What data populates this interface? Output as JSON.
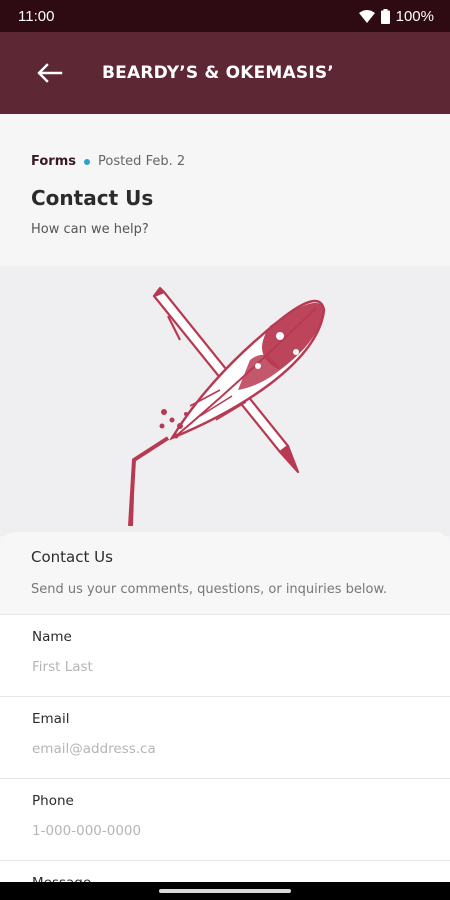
{
  "status": {
    "time": "11:00",
    "battery": "100%"
  },
  "app_bar": {
    "title": "BEARDY’S & OKEMASIS’",
    "back_icon": "arrow-left-icon"
  },
  "post": {
    "category": "Forms",
    "posted": "Posted Feb. 2",
    "title": "Contact Us",
    "subtitle": "How can we help?"
  },
  "form": {
    "title": "Contact Us",
    "description": "Send us your comments, questions, or inquiries below.",
    "fields": [
      {
        "label": "Name",
        "placeholder": "First Last"
      },
      {
        "label": "Email",
        "placeholder": "email@address.ca"
      },
      {
        "label": "Phone",
        "placeholder": "1-000-000-0000"
      },
      {
        "label": "Message"
      }
    ]
  },
  "colors": {
    "status_bar": "#2e0a12",
    "app_bar": "#5e2734",
    "accent_dot": "#26a3c9",
    "illustration": "#b83a52"
  }
}
